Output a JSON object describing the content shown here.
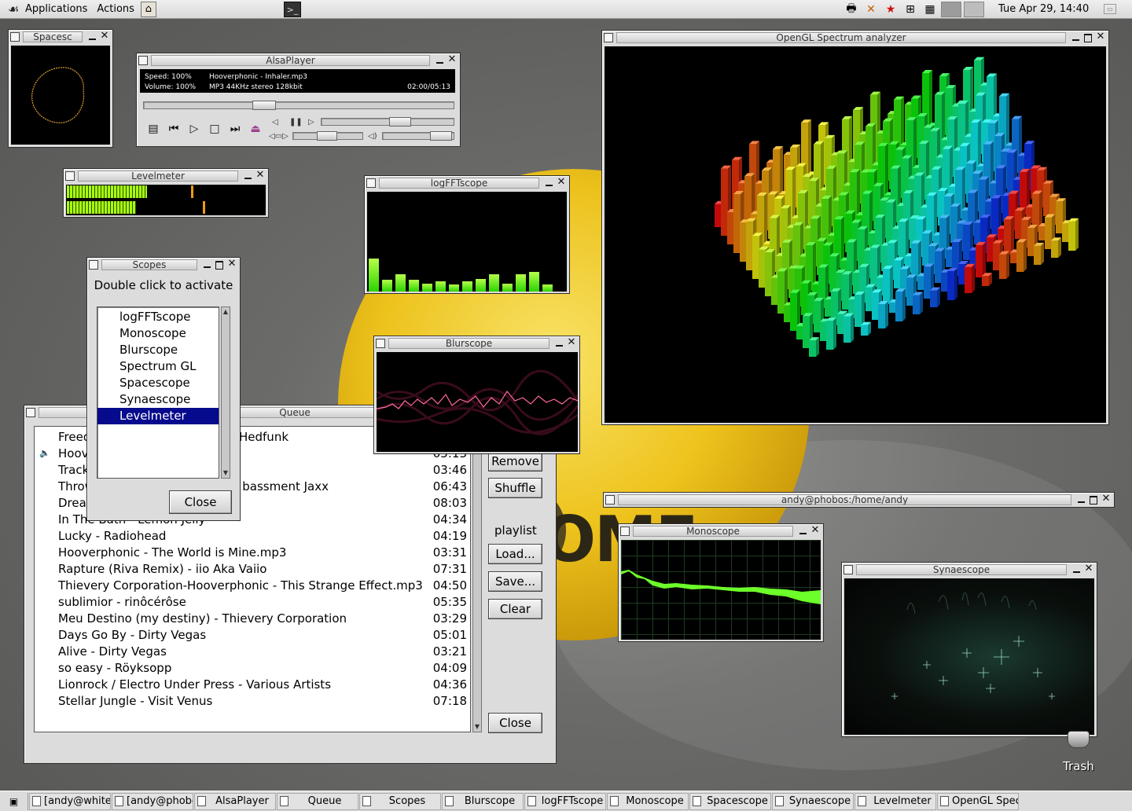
{
  "top_panel": {
    "applications": "Applications",
    "actions": "Actions",
    "clock": "Tue Apr 29, 14:40"
  },
  "spacescope": {
    "title": "Spacesc"
  },
  "alsaplayer": {
    "title": "AlsaPlayer",
    "speed": "Speed: 100%",
    "volume": "Volume: 100%",
    "track": "Hooverphonic - Inhaler.mp3",
    "format": "MP3 44KHz stereo 128kbit",
    "time": "02:00/05:13",
    "position_fraction": 0.38
  },
  "levelmeter": {
    "title": "Levelmeter",
    "left_level": 0.32,
    "right_level": 0.39,
    "left_peak": 0.63,
    "right_peak": 0.69
  },
  "logfft": {
    "title": "logFFTscope",
    "bars": [
      0.33,
      0.12,
      0.17,
      0.12,
      0.08,
      0.1,
      0.07,
      0.1,
      0.13,
      0.17,
      0.08,
      0.17,
      0.2,
      0.07
    ]
  },
  "scopes": {
    "title": "Scopes",
    "hint": "Double click to activate",
    "items": [
      "logFFTscope",
      "Monoscope",
      "Blurscope",
      "Spectrum GL",
      "Spacescope",
      "Synaescope",
      "Levelmeter"
    ],
    "selected": "Levelmeter",
    "close": "Close"
  },
  "blurscope": {
    "title": "Blurscope"
  },
  "spectrum": {
    "title": "OpenGL Spectrum analyzer"
  },
  "terminal": {
    "title": "andy@phobos:/home/andy"
  },
  "monoscope": {
    "title": "Monoscope"
  },
  "synaescope": {
    "title": "Synaescope"
  },
  "queue": {
    "title": "Queue",
    "rows": [
      {
        "title": "Freed",
        "title_tail": "Hedfunk",
        "dur": ""
      },
      {
        "title": "Hoov",
        "dur": "05:13",
        "playing": true
      },
      {
        "title": "Track",
        "dur": "03:46"
      },
      {
        "title": "Throw",
        "title_tail": "n bassment Jaxx",
        "dur": "06:43"
      },
      {
        "title": "Drea",
        "dur": "08:03"
      },
      {
        "title": "In The Bath - Lemon Jelly",
        "dur": "04:34"
      },
      {
        "title": "Lucky - Radiohead",
        "dur": "04:19"
      },
      {
        "title": "Hooverphonic - The World is Mine.mp3",
        "dur": "03:31"
      },
      {
        "title": "Rapture (Riva Remix) - iio Aka Vaiio",
        "dur": "07:31"
      },
      {
        "title": "Thievery Corporation-Hooverphonic - This Strange Effect.mp3",
        "dur": "04:50"
      },
      {
        "title": "sublimior - rinôcérôse",
        "dur": "05:35"
      },
      {
        "title": "Meu Destino (my destiny) - Thievery Corporation",
        "dur": "03:29"
      },
      {
        "title": "Days Go By - Dirty Vegas",
        "dur": "05:01"
      },
      {
        "title": "Alive - Dirty Vegas",
        "dur": "03:21"
      },
      {
        "title": "so easy - Röyksopp",
        "dur": "04:09"
      },
      {
        "title": "Lionrock / Electro Under Press - Various Artists",
        "dur": "04:36"
      },
      {
        "title": "Stellar Jungle - Visit Venus",
        "dur": "07:18"
      }
    ],
    "remove": "Remove",
    "shuffle": "Shuffle",
    "playlist_label": "playlist",
    "load": "Load...",
    "save": "Save...",
    "clear": "Clear",
    "close": "Close"
  },
  "desktop": {
    "trash": "Trash"
  },
  "taskbar": {
    "items": [
      "[andy@whites",
      "[andy@phobos",
      "AlsaPlayer",
      "Queue",
      "Scopes",
      "Blurscope",
      "logFFTscope",
      "Monoscope",
      "Spacescope",
      "Synaescope",
      "Levelmeter",
      "OpenGL Spect"
    ]
  }
}
